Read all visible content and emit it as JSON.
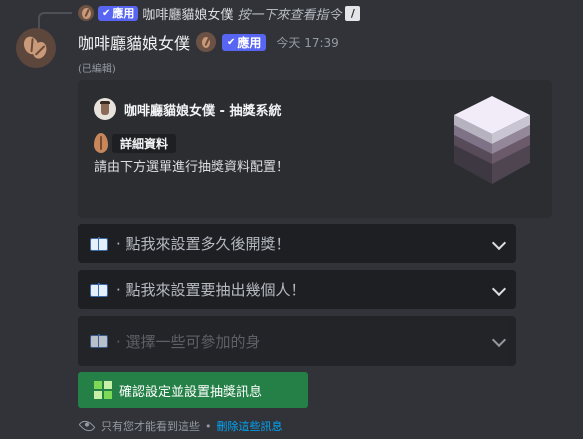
{
  "reply": {
    "app_tag": "應用",
    "username": "咖啡廳貓娘女僕",
    "command_hint": "按一下來查看指令",
    "command_icon": "slash-command-icon"
  },
  "message": {
    "username": "咖啡廳貓娘女僕",
    "app_tag": "應用",
    "timestamp": "今天 17:39",
    "edited": "(已編輯)"
  },
  "embed": {
    "author": "咖啡廳貓娘女僕 - 抽獎系統",
    "field_name": "詳細資料",
    "description": "請由下方選單進行抽獎資料配置！",
    "thumbnail": "stacked-layers-cube-icon"
  },
  "selects": [
    {
      "placeholder": "· 點我來設置多久後開獎！",
      "icon": "open-book-icon"
    },
    {
      "placeholder": "· 點我來設置要抽出幾個人！",
      "icon": "open-book-icon"
    },
    {
      "placeholder": "· 選擇一些可參加的身",
      "icon": "open-book-icon"
    }
  ],
  "confirm_button": {
    "label": "確認設定並設置抽獎訊息",
    "icon": "green-grid-icon"
  },
  "footer": {
    "ephemeral_text": "只有您才能看到這些",
    "separator": "•",
    "dismiss_link": "刪除這些訊息"
  },
  "colors": {
    "background": "#313338",
    "embed": "#2b2d31",
    "select": "#1e1f22",
    "app_tag": "#5865f2",
    "confirm": "#248046",
    "link": "#00a8fc"
  }
}
